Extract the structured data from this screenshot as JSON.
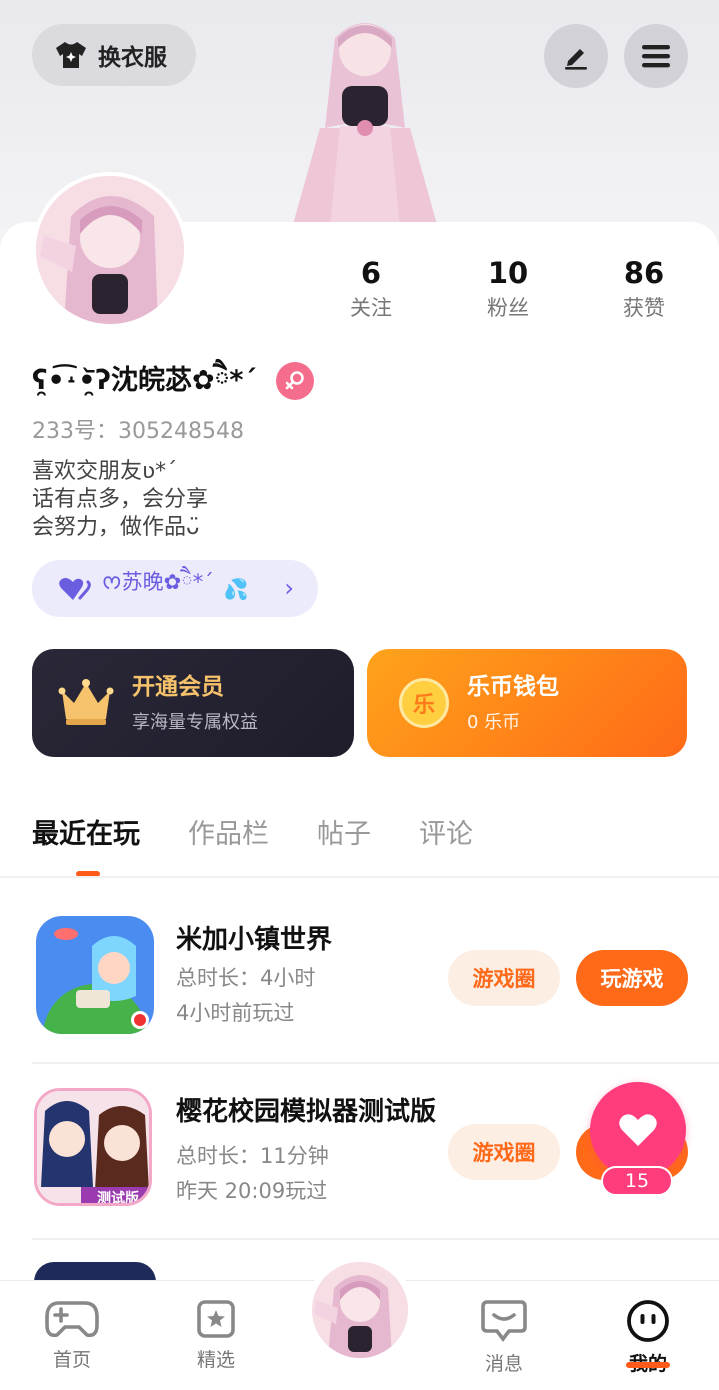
{
  "header": {
    "outfit_button": "换衣服",
    "edit_icon": "edit-icon",
    "menu_icon": "menu-icon"
  },
  "profile": {
    "username": "ʕ̯•͡˔•̯᷅ʔ沈皖苾✿ཻ*ˊ",
    "uid": "233号：305248548",
    "bio": [
      "喜欢交朋友ʋ*ˊ",
      "话有点多，会分享",
      "会努力，做作品ᴗ̈"
    ],
    "stats": [
      {
        "value": "6",
        "label": "关注"
      },
      {
        "value": "10",
        "label": "粉丝"
      },
      {
        "value": "86",
        "label": "获赞"
      }
    ],
    "friend_tag": "ᰔ苏晚✿ཻ*ˊ",
    "colors": {
      "gender": "#f56d8d",
      "accent": "#ff6a18",
      "friend_pill": "#ecebfb"
    }
  },
  "cards": {
    "vip": {
      "title": "开通会员",
      "subtitle": "享海量专属权益"
    },
    "wallet": {
      "title": "乐币钱包",
      "subtitle": "0 乐币",
      "coin_char": "乐"
    }
  },
  "tabs": [
    "最近在玩",
    "作品栏",
    "帖子",
    "评论"
  ],
  "games": [
    {
      "name": "米加小镇世界",
      "duration": "总时长：4小时",
      "last_played": "4小时前玩过",
      "circle_label": "游戏圈",
      "play_label": "玩游戏"
    },
    {
      "name": "樱花校园模拟器测试版",
      "duration": "总时长：11分钟",
      "last_played": "昨天 20:09玩过",
      "circle_label": "游戏圈",
      "play_label": "玩游戏",
      "icon_label": "测试版"
    }
  ],
  "floating_like": {
    "count": "15"
  },
  "nav": [
    {
      "label": "首页"
    },
    {
      "label": "精选"
    },
    {
      "label": "消息"
    },
    {
      "label": "我的"
    }
  ]
}
